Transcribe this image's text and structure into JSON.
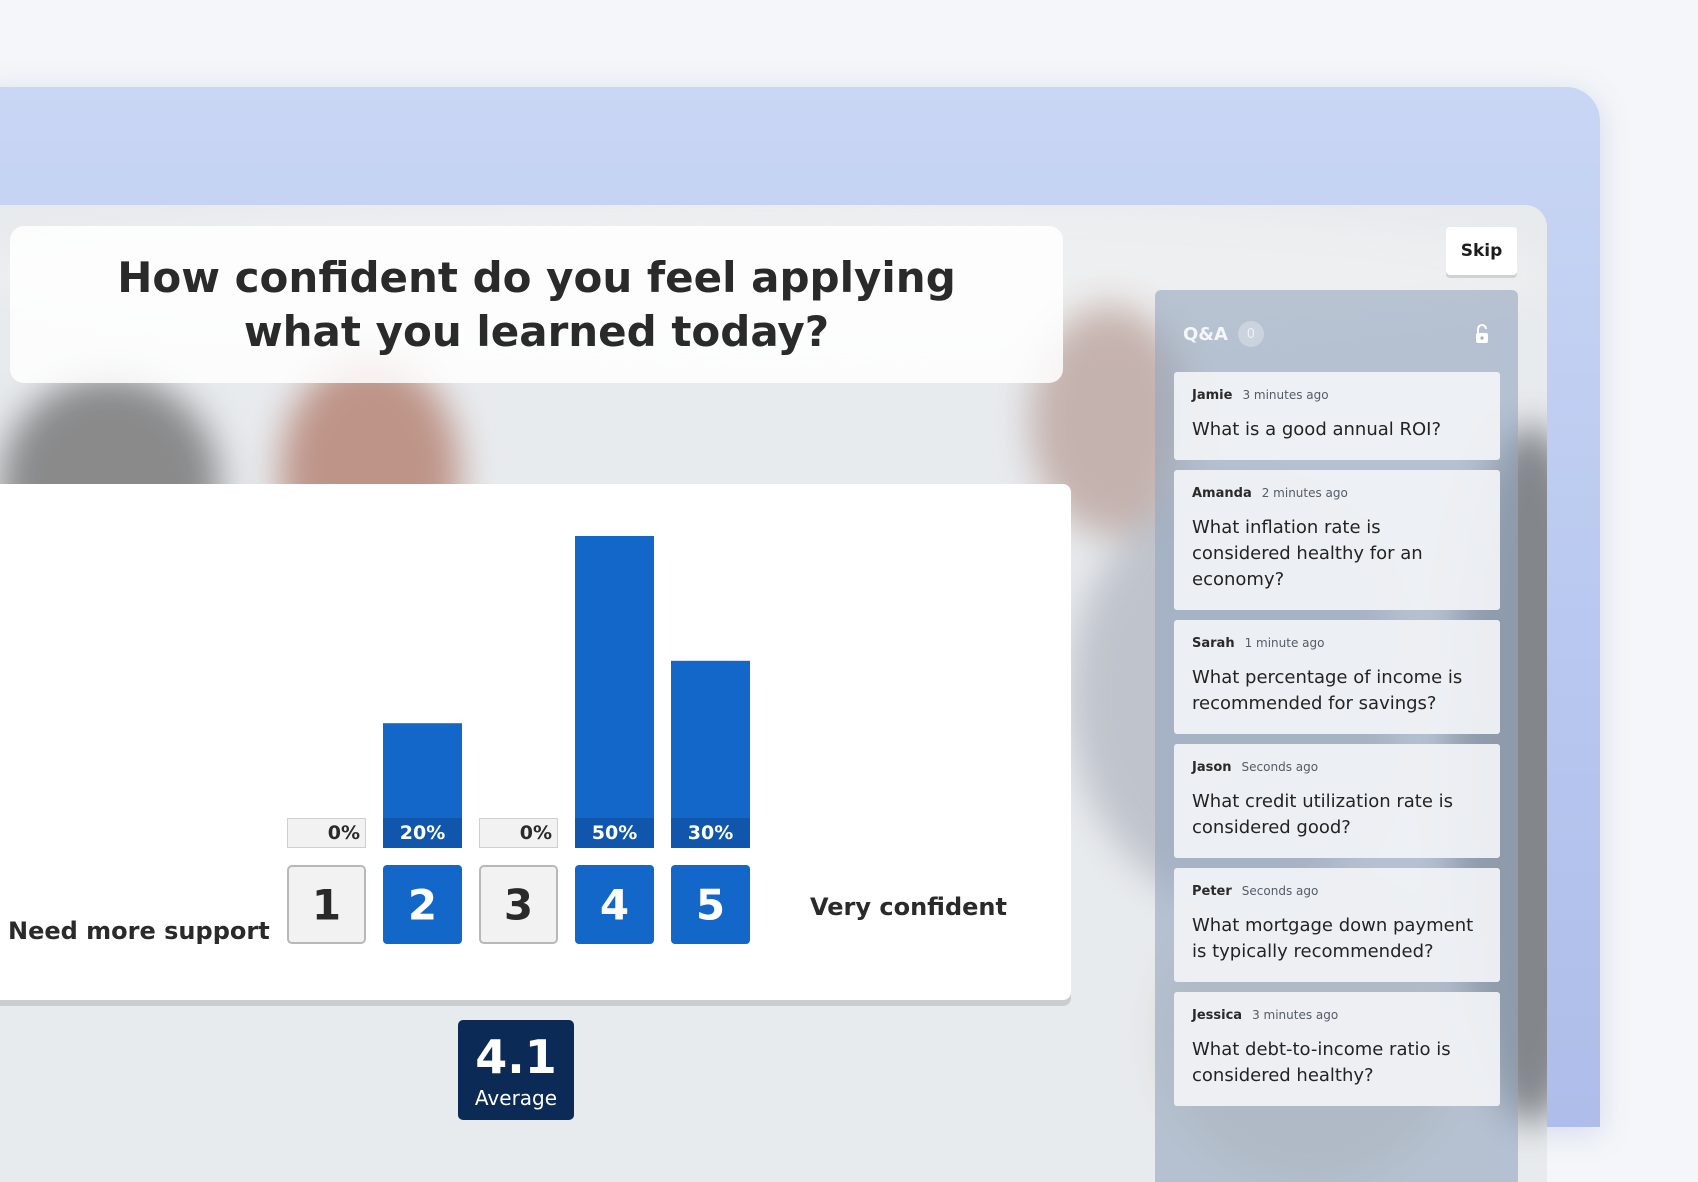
{
  "question": {
    "title": "How confident do you feel applying what you learned today?"
  },
  "skip_label": "Skip",
  "chart_data": {
    "type": "bar",
    "categories": [
      "1",
      "2",
      "3",
      "4",
      "5"
    ],
    "values": [
      0,
      20,
      0,
      50,
      30
    ],
    "value_labels": [
      "0%",
      "20%",
      "0%",
      "50%",
      "30%"
    ],
    "ylim": [
      0,
      50
    ],
    "xlabel": "",
    "ylabel": "",
    "grid": false,
    "colors": {
      "active": "#1367c9",
      "label_band": "#0f56ac",
      "inactive_fill": "#f2f2f2",
      "inactive_border": "#b8b8b8",
      "text_dark": "#2a2a2a"
    }
  },
  "scale": {
    "low_label": "Need more support",
    "high_label": "Very confident"
  },
  "average": {
    "value": "4.1",
    "label": "Average"
  },
  "qa": {
    "title": "Q&A",
    "count": "0",
    "lock_icon": "unlocked-padlock-icon",
    "items": [
      {
        "author": "Jamie",
        "time": "3 minutes ago",
        "text": "What is a good annual ROI?"
      },
      {
        "author": "Amanda",
        "time": "2 minutes ago",
        "text": "What inflation rate is considered healthy for an economy?"
      },
      {
        "author": "Sarah",
        "time": "1 minute ago",
        "text": "What percentage of income is recommended for savings?"
      },
      {
        "author": "Jason",
        "time": "Seconds ago",
        "text": "What credit utilization rate is considered good?"
      },
      {
        "author": "Peter",
        "time": "Seconds ago",
        "text": "What mortgage down payment is typically recommended?"
      },
      {
        "author": "Jessica",
        "time": "3 minutes ago",
        "text": "What debt-to-income ratio is considered healthy?"
      }
    ]
  }
}
